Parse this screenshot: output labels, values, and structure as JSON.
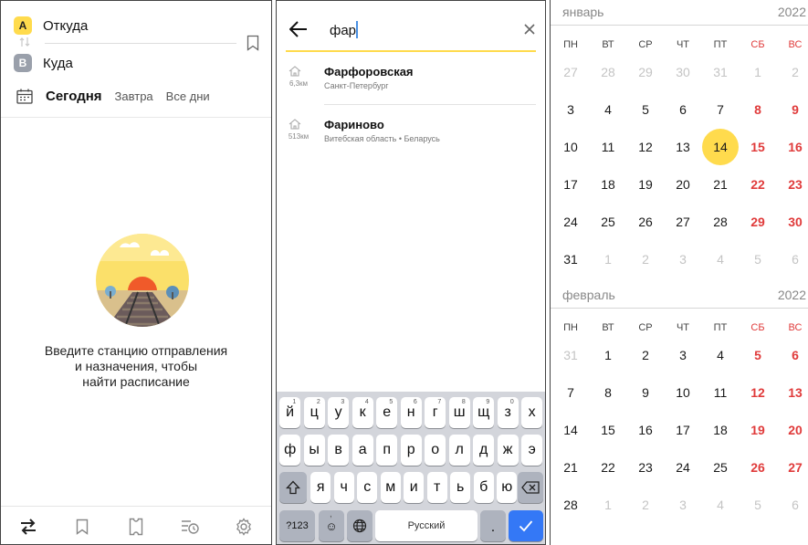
{
  "screen1": {
    "from_label": "Откуда",
    "to_label": "Куда",
    "badge_a": "A",
    "badge_b": "B",
    "date_today": "Сегодня",
    "date_tomorrow": "Завтра",
    "date_all": "Все дни",
    "hint_lines": [
      "Введите станцию отправления",
      "и назначения, чтобы",
      "найти расписание"
    ],
    "tabs": [
      "route-icon",
      "bookmark-icon",
      "map-icon",
      "history-icon",
      "gear-icon"
    ]
  },
  "screen2": {
    "search_value": "фар",
    "results": [
      {
        "title": "Фарфоровская",
        "subtitle": "Санкт-Петербург",
        "distance": "6,3км"
      },
      {
        "title": "Фариново",
        "subtitle": "Витебская область • Беларусь",
        "distance": "513км"
      }
    ],
    "keyboard": {
      "row1": [
        "й",
        "ц",
        "у",
        "к",
        "е",
        "н",
        "г",
        "ш",
        "щ",
        "з",
        "х"
      ],
      "row1_hints": [
        "1",
        "2",
        "3",
        "4",
        "5",
        "6",
        "7",
        "8",
        "9",
        "0",
        ""
      ],
      "row2": [
        "ф",
        "ы",
        "в",
        "а",
        "п",
        "р",
        "о",
        "л",
        "д",
        "ж",
        "э"
      ],
      "row3": [
        "я",
        "ч",
        "с",
        "м",
        "и",
        "т",
        "ь",
        "б",
        "ю"
      ],
      "symbols_key": "?123",
      "emoji_key": "☺",
      "comma_key": ",",
      "space_label": "Русский",
      "period_key": "."
    }
  },
  "screen3": {
    "weekdays": [
      "ПН",
      "ВТ",
      "СР",
      "ЧТ",
      "ПТ",
      "СБ",
      "ВС"
    ],
    "months": [
      {
        "name": "январь",
        "year": "2022",
        "weeks": [
          [
            "27",
            "28",
            "29",
            "30",
            "31",
            "1",
            "2"
          ],
          [
            "3",
            "4",
            "5",
            "6",
            "7",
            "8",
            "9"
          ],
          [
            "10",
            "11",
            "12",
            "13",
            "14",
            "15",
            "16"
          ],
          [
            "17",
            "18",
            "19",
            "20",
            "21",
            "22",
            "23"
          ],
          [
            "24",
            "25",
            "26",
            "27",
            "28",
            "29",
            "30"
          ],
          [
            "31",
            "1",
            "2",
            "3",
            "4",
            "5",
            "6"
          ]
        ]
      },
      {
        "name": "февраль",
        "year": "2022",
        "weeks": [
          [
            "31",
            "1",
            "2",
            "3",
            "4",
            "5",
            "6"
          ],
          [
            "7",
            "8",
            "9",
            "10",
            "11",
            "12",
            "13"
          ],
          [
            "14",
            "15",
            "16",
            "17",
            "18",
            "19",
            "20"
          ],
          [
            "21",
            "22",
            "23",
            "24",
            "25",
            "26",
            "27"
          ],
          [
            "28",
            "1",
            "2",
            "3",
            "4",
            "5",
            "6"
          ]
        ]
      }
    ],
    "selected_day": "14",
    "colors": {
      "accent": "#ffdb4d",
      "weekend": "#e03b3b",
      "muted": "#c4c4c4"
    }
  }
}
